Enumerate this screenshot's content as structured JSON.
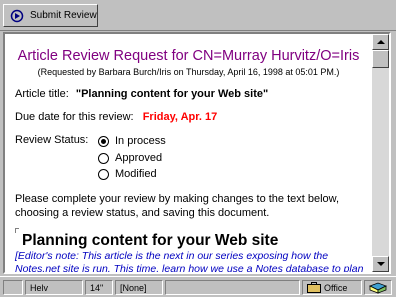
{
  "toolbar": {
    "submit_label": "Submit Review"
  },
  "document": {
    "title": "Article Review Request for CN=Murray Hurvitz/O=Iris",
    "subtitle": "(Requested by Barbara Burch/Iris on Thursday, April  16, 1998 at 05:01 PM.)",
    "article_title_label": "Article title:",
    "article_title_value": "\"Planning content for your Web site\"",
    "due_label": "Due date for this review:",
    "due_value": "Friday, Apr. 17",
    "status_label": "Review Status:",
    "status_options": [
      {
        "label": "In process",
        "checked": true
      },
      {
        "label": "Approved",
        "checked": false
      },
      {
        "label": "Modified",
        "checked": false
      }
    ],
    "instructions": "Please complete your review by making changes to the text below, choosing a review status, and saving this document.",
    "article_heading": "Planning content for your Web site",
    "article_body": "[Editor's note: This article is the next in our series exposing how the Notes.net site is run. This time, learn how we use a Notes database to plan the content"
  },
  "statusbar": {
    "font": "Helv",
    "size": "14\"",
    "style": "[None]",
    "location": "Office"
  },
  "colors": {
    "title": "#800080",
    "due": "#ff0000",
    "body_note": "#0000c0"
  }
}
